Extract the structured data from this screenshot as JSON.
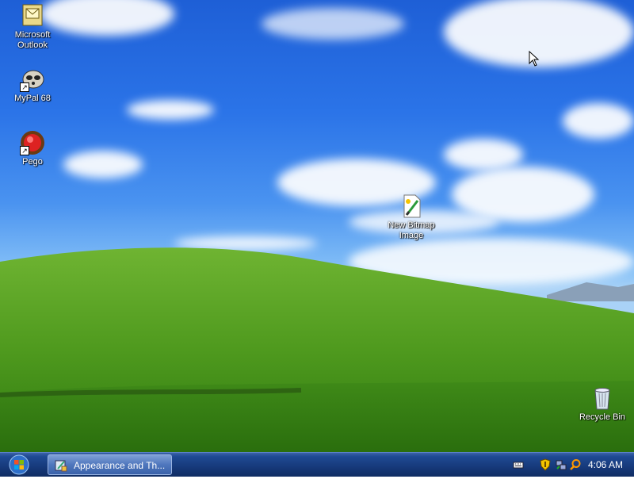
{
  "desktop": {
    "icons": [
      {
        "label_line1": "Microsoft",
        "label_line2": "Outlook",
        "icon": "outlook-icon"
      },
      {
        "label_line1": "MyPal 68",
        "label_line2": "",
        "icon": "mypal-icon"
      },
      {
        "label_line1": "Pego",
        "label_line2": "",
        "icon": "pego-icon"
      },
      {
        "label_line1": "New Bitmap",
        "label_line2": "Image",
        "icon": "bitmap-file-icon"
      },
      {
        "label_line1": "Recycle Bin",
        "label_line2": "",
        "icon": "recycle-bin-icon"
      }
    ]
  },
  "taskbar": {
    "start_icon": "windows-start-orb",
    "task_button_label": "Appearance and Th...",
    "task_button_icon": "control-panel-icon",
    "clock": "4:06 AM",
    "tray_icons": [
      "keyboard-icon",
      "security-shield-icon",
      "network-icon",
      "search-icon"
    ]
  },
  "colors": {
    "sky": "#2b74e8",
    "grass": "#4c9a1c",
    "taskbar": "#16397a"
  }
}
